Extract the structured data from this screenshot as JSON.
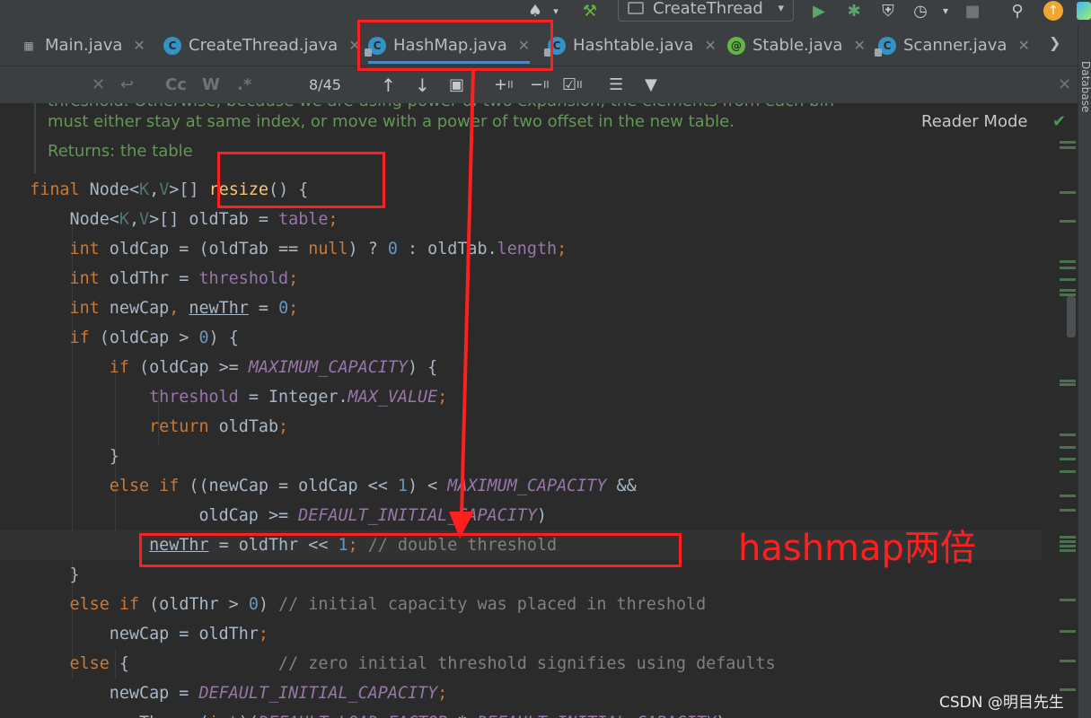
{
  "toolbar": {
    "run_config_label": "CreateThread",
    "run_config_arrow": "▾"
  },
  "tabs": [
    {
      "label": "Main.java",
      "icon": "main-class-icon",
      "active": false
    },
    {
      "label": "CreateThread.java",
      "icon": "class-icon",
      "active": false
    },
    {
      "label": "HashMap.java",
      "icon": "class-icon",
      "active": true
    },
    {
      "label": "Hashtable.java",
      "icon": "class-icon",
      "active": false
    },
    {
      "label": "Stable.java",
      "icon": "annotation-icon",
      "active": false
    },
    {
      "label": "Scanner.java",
      "icon": "class-icon",
      "active": false
    }
  ],
  "find": {
    "match_count": "8/45",
    "case_toggle": "Cc",
    "word_toggle": "W",
    "regex_toggle": ".*"
  },
  "side_panel": {
    "database_label": "Database"
  },
  "editor": {
    "reader_mode": "Reader Mode",
    "doc_lines": [
      "threshold. Otherwise, because we are using power-of-two expansion, the elements from each bin",
      "must either stay at same index, or move with a power of two offset in the new table.",
      "Returns: the table"
    ]
  },
  "annotation": {
    "label": "hashmap两倍"
  },
  "watermark": "CSDN @明目先生",
  "colors": {
    "annotation_red": "#ff1f1f",
    "keyword": "#cc7832",
    "method": "#ffc66d",
    "field": "#9876aa",
    "number": "#6897bb",
    "comment": "#808080",
    "javadoc": "#629755"
  }
}
